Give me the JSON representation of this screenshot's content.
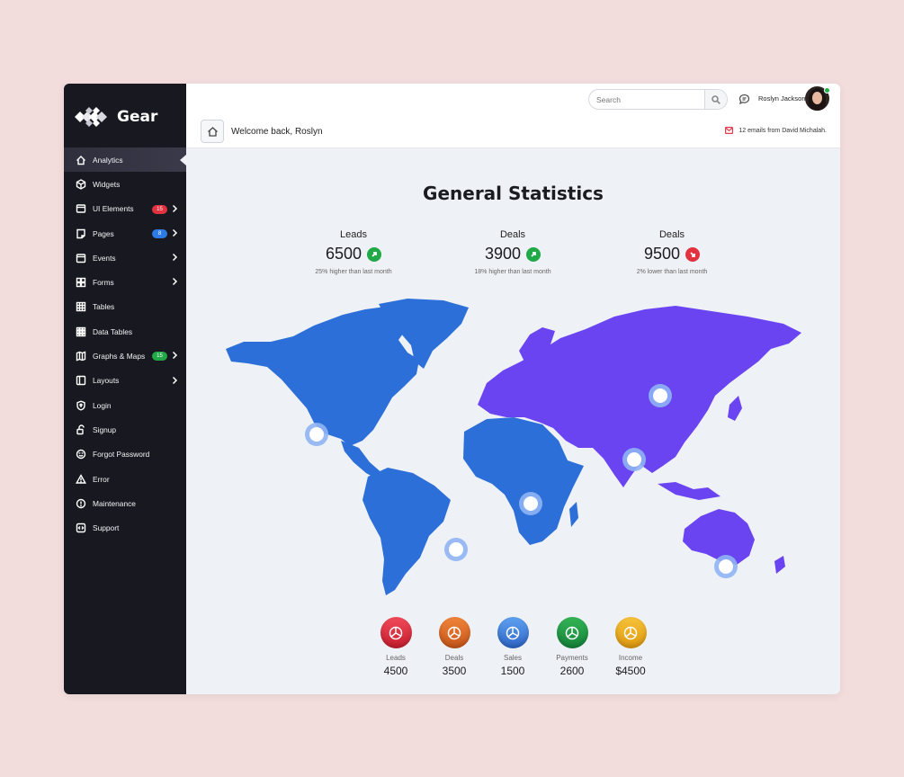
{
  "brand": {
    "name": "Gear"
  },
  "sidebar": {
    "items": [
      {
        "label": "Analytics",
        "icon": "home-icon"
      },
      {
        "label": "Widgets",
        "icon": "cube-icon"
      },
      {
        "label": "UI Elements",
        "icon": "layout-icon",
        "badge": "15",
        "badge_color": "#e2323f"
      },
      {
        "label": "Pages",
        "icon": "page-icon",
        "badge": "8",
        "badge_color": "#2e7ae6"
      },
      {
        "label": "Events",
        "icon": "calendar-icon"
      },
      {
        "label": "Forms",
        "icon": "grid-icon"
      },
      {
        "label": "Tables",
        "icon": "table-icon"
      },
      {
        "label": "Data Tables",
        "icon": "data-table-icon"
      },
      {
        "label": "Graphs & Maps",
        "icon": "map-icon",
        "badge": "15",
        "badge_color": "#21a847"
      },
      {
        "label": "Layouts",
        "icon": "sidebar-layout-icon"
      },
      {
        "label": "Login",
        "icon": "shield-icon"
      },
      {
        "label": "Signup",
        "icon": "lock-icon"
      },
      {
        "label": "Forgot Password",
        "icon": "smile-icon"
      },
      {
        "label": "Error",
        "icon": "warning-icon"
      },
      {
        "label": "Maintenance",
        "icon": "alert-circle-icon"
      },
      {
        "label": "Support",
        "icon": "code-icon"
      }
    ]
  },
  "header": {
    "search_placeholder": "Search",
    "user_name": "Roslyn Jackson",
    "welcome": "Welcome back, Roslyn",
    "mail_note": "12 emails from David Michalah."
  },
  "main": {
    "title": "General Statistics",
    "stats": [
      {
        "label": "Leads",
        "value": "6500",
        "trend": "up",
        "color": "#21a847",
        "note": "25% higher than last month"
      },
      {
        "label": "Deals",
        "value": "3900",
        "trend": "up",
        "color": "#21a847",
        "note": "18% higher than last month"
      },
      {
        "label": "Deals",
        "value": "9500",
        "trend": "down",
        "color": "#e2323f",
        "note": "2% lower than last month"
      }
    ],
    "map_colors": {
      "primary": "#2c6fd8",
      "secondary": "#6b44f2"
    },
    "kpis": [
      {
        "label": "Leads",
        "value": "4500",
        "color_top": "#f04a5a",
        "color_bottom": "#c81e2e"
      },
      {
        "label": "Deals",
        "value": "3500",
        "color_top": "#f0843a",
        "color_bottom": "#c8561a"
      },
      {
        "label": "Sales",
        "value": "1500",
        "color_top": "#5fa1f0",
        "color_bottom": "#2f66c8"
      },
      {
        "label": "Payments",
        "value": "2600",
        "color_top": "#34b455",
        "color_bottom": "#15843a"
      },
      {
        "label": "Income",
        "value": "$4500",
        "color_top": "#f6c23a",
        "color_bottom": "#e09a10"
      }
    ]
  }
}
